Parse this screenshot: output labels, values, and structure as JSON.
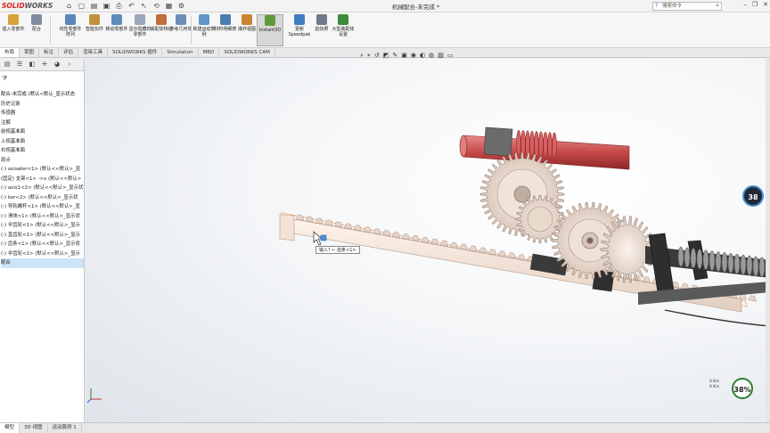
{
  "app": {
    "logo_solid": "SOLID",
    "logo_works": "WORKS",
    "document_title": "机械配合-未完成 *",
    "help_search": "搜索命令"
  },
  "ribbon": {
    "buttons": [
      {
        "label": "插入零部件",
        "color": "#d8a23a"
      },
      {
        "label": "配合",
        "color": "#7f8c9d"
      },
      {
        "label": "线性零部件阵列",
        "color": "#5a86b8"
      },
      {
        "label": "智能扣件",
        "color": "#c0913a"
      },
      {
        "label": "移动零部件",
        "color": "#5e8dbd"
      },
      {
        "label": "显示隐藏的零部件",
        "color": "#9aa7b8"
      },
      {
        "label": "装配体特征",
        "color": "#c06e3c"
      },
      {
        "label": "参考几何体",
        "color": "#6c8fb8"
      },
      {
        "label": "新建运动算例",
        "color": "#5e97c7"
      },
      {
        "label": "材料明细表",
        "color": "#4d7db0"
      },
      {
        "label": "爆炸视图",
        "color": "#c9842f"
      },
      {
        "label": "Instant3D",
        "color": "#5f9b3a"
      },
      {
        "label": "更新Speedpak",
        "color": "#3f7fc0"
      },
      {
        "label": "拍快照",
        "color": "#6c7a8a"
      },
      {
        "label": "大型装配体设置",
        "color": "#3c8d3c"
      }
    ]
  },
  "tabs": [
    "布局",
    "草图",
    "标注",
    "评估",
    "渲染工具",
    "SOLIDWORKS 插件",
    "Simulation",
    "MBD",
    "SOLIDWORKS CAM"
  ],
  "feature_tree": {
    "items": [
      "配合-未完成 (默认<默认_显示状态",
      "历史记录",
      "传感器",
      "注解",
      "前视基准面",
      "上视基准面",
      "右视基准面",
      "原点",
      "(-) axisater<1> (默认<<默认>_显",
      "(固定) 支架<1> ->x (默认<<默认>",
      "(-) axis1<2> (默认<<默认>_显示状",
      "(-) kor<2> (默认<<默认>_显示状",
      "(-) 导轨螺杆<1> (默认<<默认>_显",
      "(-) 滑块<1> (默认<<默认>_显示状",
      "(-) 伞齿轮<1> (默认<<默认>_显示",
      "(-) 直齿轮<1> (默认<<默认>_显示",
      "(-) 齿条<1> (默认<<默认>_显示状",
      "(-) 伞齿轮<2> (默认<<默认>_显示",
      "配合"
    ]
  },
  "viewport": {
    "tooltip": "输入? ← 齿条<1>",
    "gauge_large": "38",
    "gauge_small": "38%",
    "net_up": "0 K/s",
    "net_down": "0 K/s"
  },
  "bottom_tabs": [
    "模型",
    "3D 视图",
    "运动算例 1"
  ]
}
